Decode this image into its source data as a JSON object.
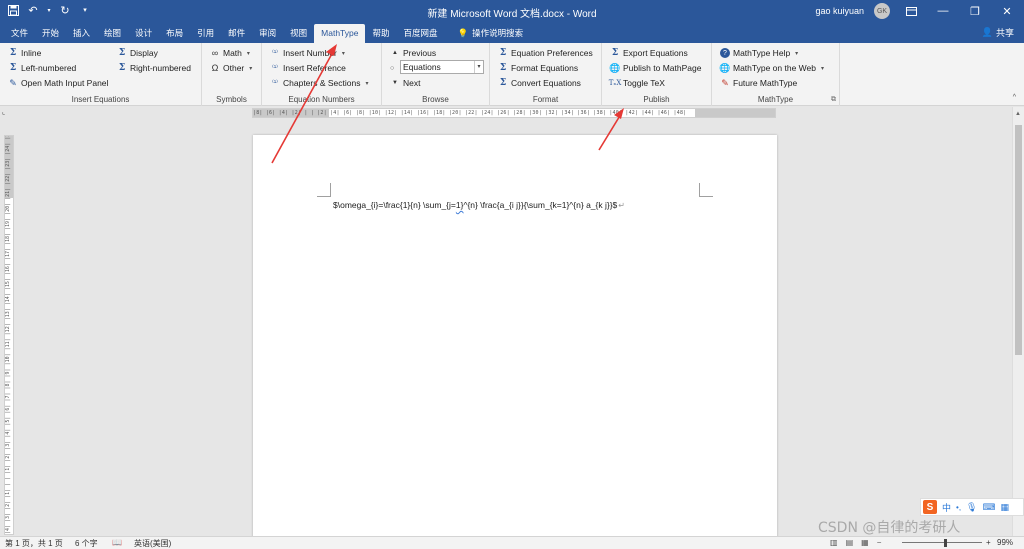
{
  "window": {
    "title": "新建 Microsoft Word 文档.docx - Word",
    "user_name": "gao kuiyuan",
    "avatar_initials": "GK"
  },
  "tabs": [
    "文件",
    "开始",
    "插入",
    "绘图",
    "设计",
    "布局",
    "引用",
    "邮件",
    "审阅",
    "视图",
    "MathType",
    "帮助",
    "百度网盘"
  ],
  "active_tab": "MathType",
  "tell_me": "操作说明搜索",
  "share": "共享",
  "ribbon": {
    "insert_equations": {
      "label": "Insert Equations",
      "inline": "Inline",
      "display": "Display",
      "left_numbered": "Left-numbered",
      "right_numbered": "Right-numbered",
      "open_panel": "Open Math Input Panel"
    },
    "symbols": {
      "label": "Symbols",
      "math": "Math",
      "other": "Other"
    },
    "equation_numbers": {
      "label": "Equation Numbers",
      "insert_number": "Insert Number",
      "insert_reference": "Insert Reference",
      "chapters_sections": "Chapters & Sections"
    },
    "browse": {
      "label": "Browse",
      "previous": "Previous",
      "combo_value": "Equations",
      "next": "Next"
    },
    "format": {
      "label": "Format",
      "equation_preferences": "Equation Preferences",
      "format_equations": "Format Equations",
      "convert_equations": "Convert Equations"
    },
    "publish": {
      "label": "Publish",
      "export_equations": "Export Equations",
      "publish_mathpage": "Publish to MathPage",
      "toggle_tex": "Toggle TeX"
    },
    "mathtype": {
      "label": "MathType",
      "help": "MathType Help",
      "on_web": "MathType on the Web",
      "future": "Future MathType"
    }
  },
  "ruler": {
    "horizontal": "|8| |6| |4| |2| | | |2| |4| |6| |8| |10| |12| |14| |16| |18| |20| |22| |24| |26| |28| |30| |32| |34| |36| |38| |40| |42| |44| |46| |48|",
    "vertical": "|4| |3| |2| |1| | | |1| |2| |3| |4| |5| |6| |7| |8| |9| |10| |11| |12| |13| |14| |15| |16| |17| |18| |19| |20| |21| |22| |23| |24| |25|"
  },
  "document": {
    "text_before": "$\\omega_{i}=\\frac{1}{n} \\sum_{j=",
    "text_squiggle": "1}",
    "text_after": "^{n} \\frac{a_{i j}}{\\sum_{k=1}^{n} a_{k j}}$"
  },
  "status": {
    "page": "第 1 页，共 1 页",
    "words": "6 个字",
    "language": "英语(美国)",
    "zoom": "99%"
  },
  "ime": {
    "lang": "中"
  },
  "watermark": "CSDN @自律的考研人",
  "colors": {
    "word_blue": "#2b579a",
    "arrow_red": "#e53935"
  }
}
